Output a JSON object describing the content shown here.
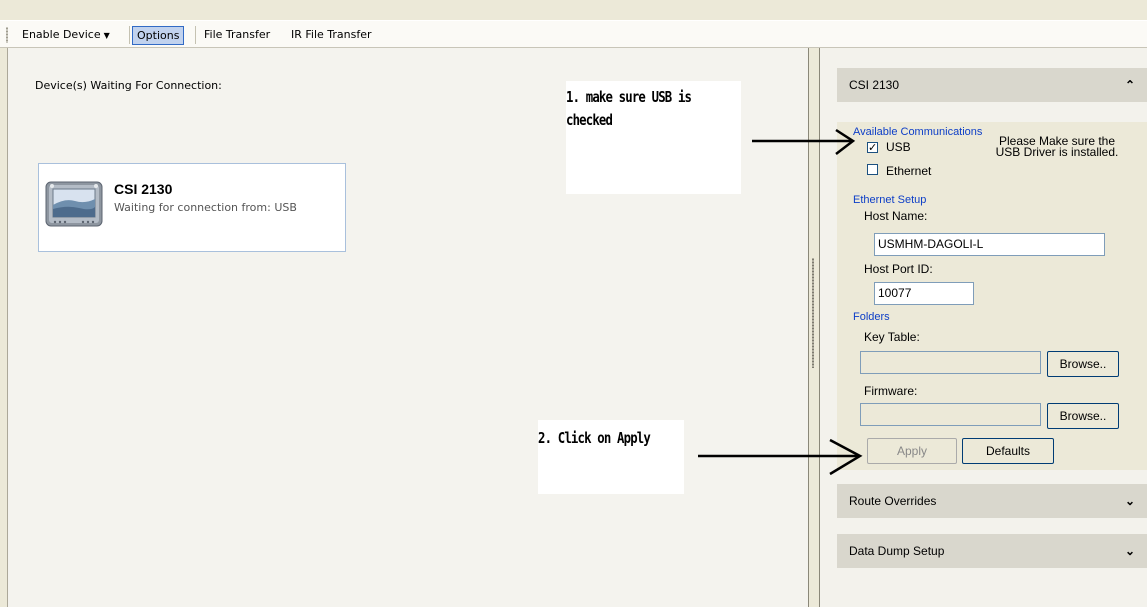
{
  "toolbar": {
    "enable_device": "Enable Device",
    "options": "Options",
    "file_transfer": "File Transfer",
    "ir_file_transfer": "IR File Transfer"
  },
  "main": {
    "waiting_label": "Device(s) Waiting For Connection:",
    "device": {
      "name": "CSI 2130",
      "status": "Waiting for connection from: USB"
    }
  },
  "panel": {
    "title": "CSI 2130",
    "available_comms": "Available Communications",
    "usb_label": "USB",
    "usb_checked": true,
    "ethernet_label": "Ethernet",
    "ethernet_checked": false,
    "usb_note": "Please Make sure the USB Driver is installed.",
    "ethernet_setup": "Ethernet Setup",
    "host_name_label": "Host Name:",
    "host_name_value": "USMHM-DAGOLI-L",
    "host_port_label": "Host Port ID:",
    "host_port_value": "10077",
    "folders": "Folders",
    "key_table_label": "Key Table:",
    "key_table_value": "",
    "firmware_label": "Firmware:",
    "firmware_value": "",
    "browse1": "Browse..",
    "browse2": "Browse..",
    "apply": "Apply",
    "defaults": "Defaults"
  },
  "route_overrides": "Route Overrides",
  "data_dump_setup": "Data Dump Setup",
  "annotations": {
    "note1_line1": "1. make sure USB is",
    "note1_line2": "checked",
    "note2": "2. Click on Apply"
  }
}
